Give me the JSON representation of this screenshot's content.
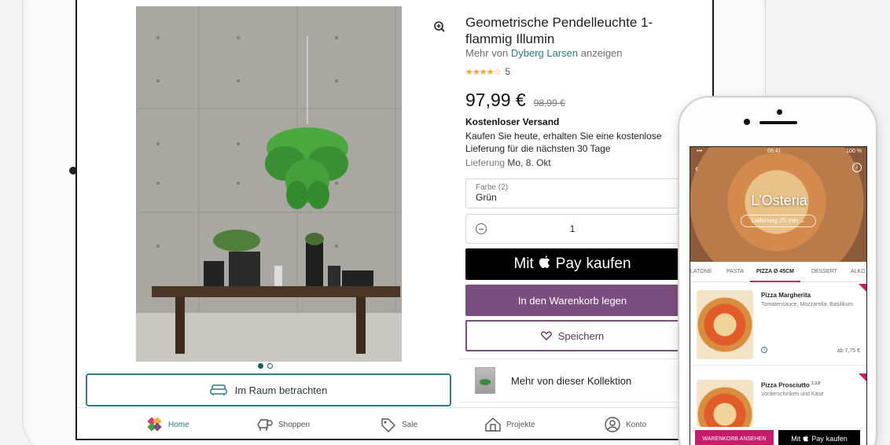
{
  "product": {
    "title": "Geometrische Pendelleuchte 1-flammig Illumin",
    "brand_prefix": "Mehr von",
    "brand": "Dyberg Larsen",
    "brand_suffix": "anzeigen",
    "rating_stars": "★★★★☆",
    "rating_count": "5",
    "price": "97,99 €",
    "old_price": "98,99 €",
    "shipping_title": "Kostenloser Versand",
    "shipping_desc": "Kaufen Sie heute, erhalten Sie eine kostenlose Lieferung für die nächsten 30 Tage",
    "delivery_label": "Lieferung",
    "delivery_date": "Mo, 8. Okt",
    "color_label": "Farbe (2)",
    "color_value": "Grün",
    "quantity": "1",
    "applepay_prefix": "Mit",
    "applepay_pay": "Pay",
    "applepay_suffix": "kaufen",
    "cart_label": "In den Warenkorb legen",
    "save_label": "Speichern",
    "collection_label": "Mehr von dieser Kollektion",
    "room_label": "Im Raum betrachten"
  },
  "nav": {
    "home": "Home",
    "shop": "Shoppen",
    "sale": "Sale",
    "projects": "Projekte",
    "account": "Konto"
  },
  "phone": {
    "time": "09:41",
    "battery": "100 %",
    "restaurant": "L'Osteria",
    "delivery": "Lieferung 25 min ⌄",
    "categories": [
      "LATONE",
      "PASTA",
      "PIZZA Ø 45CM",
      "DESSERT",
      "ALKO"
    ],
    "items": [
      {
        "name": "Pizza Margherita",
        "desc": "Tomatensauce, Mozzarella, Basilikum",
        "price": "ab 7,75 €"
      },
      {
        "name": "Pizza Prosciutto",
        "sup": "2,3,8",
        "desc": "Vorderschinken und Käse"
      }
    ],
    "cart_button": "WARENKORB ANSEHEN",
    "pay_prefix": "Mit",
    "pay_pay": "Pay",
    "pay_suffix": "kaufen"
  },
  "colors": {
    "teal": "#2f7d86",
    "purple": "#7a4f7f",
    "magenta": "#c51d6a"
  }
}
